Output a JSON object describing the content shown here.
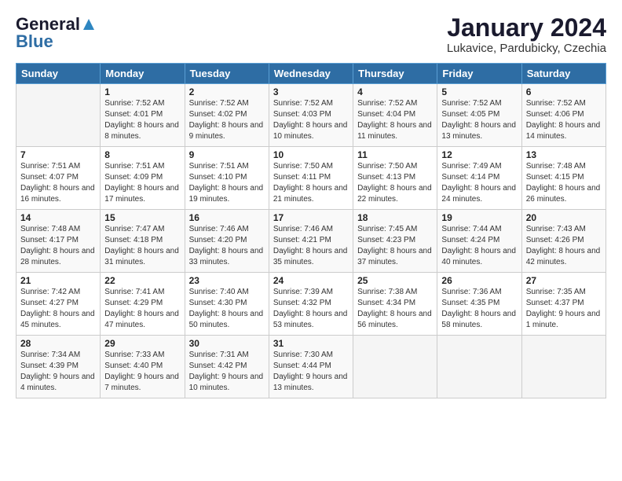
{
  "header": {
    "logo_general": "General",
    "logo_blue": "Blue",
    "title": "January 2024",
    "location": "Lukavice, Pardubicky, Czechia"
  },
  "days_of_week": [
    "Sunday",
    "Monday",
    "Tuesday",
    "Wednesday",
    "Thursday",
    "Friday",
    "Saturday"
  ],
  "weeks": [
    [
      {
        "day": "",
        "sunrise": "",
        "sunset": "",
        "daylight": ""
      },
      {
        "day": "1",
        "sunrise": "Sunrise: 7:52 AM",
        "sunset": "Sunset: 4:01 PM",
        "daylight": "Daylight: 8 hours and 8 minutes."
      },
      {
        "day": "2",
        "sunrise": "Sunrise: 7:52 AM",
        "sunset": "Sunset: 4:02 PM",
        "daylight": "Daylight: 8 hours and 9 minutes."
      },
      {
        "day": "3",
        "sunrise": "Sunrise: 7:52 AM",
        "sunset": "Sunset: 4:03 PM",
        "daylight": "Daylight: 8 hours and 10 minutes."
      },
      {
        "day": "4",
        "sunrise": "Sunrise: 7:52 AM",
        "sunset": "Sunset: 4:04 PM",
        "daylight": "Daylight: 8 hours and 11 minutes."
      },
      {
        "day": "5",
        "sunrise": "Sunrise: 7:52 AM",
        "sunset": "Sunset: 4:05 PM",
        "daylight": "Daylight: 8 hours and 13 minutes."
      },
      {
        "day": "6",
        "sunrise": "Sunrise: 7:52 AM",
        "sunset": "Sunset: 4:06 PM",
        "daylight": "Daylight: 8 hours and 14 minutes."
      }
    ],
    [
      {
        "day": "7",
        "sunrise": "Sunrise: 7:51 AM",
        "sunset": "Sunset: 4:07 PM",
        "daylight": "Daylight: 8 hours and 16 minutes."
      },
      {
        "day": "8",
        "sunrise": "Sunrise: 7:51 AM",
        "sunset": "Sunset: 4:09 PM",
        "daylight": "Daylight: 8 hours and 17 minutes."
      },
      {
        "day": "9",
        "sunrise": "Sunrise: 7:51 AM",
        "sunset": "Sunset: 4:10 PM",
        "daylight": "Daylight: 8 hours and 19 minutes."
      },
      {
        "day": "10",
        "sunrise": "Sunrise: 7:50 AM",
        "sunset": "Sunset: 4:11 PM",
        "daylight": "Daylight: 8 hours and 21 minutes."
      },
      {
        "day": "11",
        "sunrise": "Sunrise: 7:50 AM",
        "sunset": "Sunset: 4:13 PM",
        "daylight": "Daylight: 8 hours and 22 minutes."
      },
      {
        "day": "12",
        "sunrise": "Sunrise: 7:49 AM",
        "sunset": "Sunset: 4:14 PM",
        "daylight": "Daylight: 8 hours and 24 minutes."
      },
      {
        "day": "13",
        "sunrise": "Sunrise: 7:48 AM",
        "sunset": "Sunset: 4:15 PM",
        "daylight": "Daylight: 8 hours and 26 minutes."
      }
    ],
    [
      {
        "day": "14",
        "sunrise": "Sunrise: 7:48 AM",
        "sunset": "Sunset: 4:17 PM",
        "daylight": "Daylight: 8 hours and 28 minutes."
      },
      {
        "day": "15",
        "sunrise": "Sunrise: 7:47 AM",
        "sunset": "Sunset: 4:18 PM",
        "daylight": "Daylight: 8 hours and 31 minutes."
      },
      {
        "day": "16",
        "sunrise": "Sunrise: 7:46 AM",
        "sunset": "Sunset: 4:20 PM",
        "daylight": "Daylight: 8 hours and 33 minutes."
      },
      {
        "day": "17",
        "sunrise": "Sunrise: 7:46 AM",
        "sunset": "Sunset: 4:21 PM",
        "daylight": "Daylight: 8 hours and 35 minutes."
      },
      {
        "day": "18",
        "sunrise": "Sunrise: 7:45 AM",
        "sunset": "Sunset: 4:23 PM",
        "daylight": "Daylight: 8 hours and 37 minutes."
      },
      {
        "day": "19",
        "sunrise": "Sunrise: 7:44 AM",
        "sunset": "Sunset: 4:24 PM",
        "daylight": "Daylight: 8 hours and 40 minutes."
      },
      {
        "day": "20",
        "sunrise": "Sunrise: 7:43 AM",
        "sunset": "Sunset: 4:26 PM",
        "daylight": "Daylight: 8 hours and 42 minutes."
      }
    ],
    [
      {
        "day": "21",
        "sunrise": "Sunrise: 7:42 AM",
        "sunset": "Sunset: 4:27 PM",
        "daylight": "Daylight: 8 hours and 45 minutes."
      },
      {
        "day": "22",
        "sunrise": "Sunrise: 7:41 AM",
        "sunset": "Sunset: 4:29 PM",
        "daylight": "Daylight: 8 hours and 47 minutes."
      },
      {
        "day": "23",
        "sunrise": "Sunrise: 7:40 AM",
        "sunset": "Sunset: 4:30 PM",
        "daylight": "Daylight: 8 hours and 50 minutes."
      },
      {
        "day": "24",
        "sunrise": "Sunrise: 7:39 AM",
        "sunset": "Sunset: 4:32 PM",
        "daylight": "Daylight: 8 hours and 53 minutes."
      },
      {
        "day": "25",
        "sunrise": "Sunrise: 7:38 AM",
        "sunset": "Sunset: 4:34 PM",
        "daylight": "Daylight: 8 hours and 56 minutes."
      },
      {
        "day": "26",
        "sunrise": "Sunrise: 7:36 AM",
        "sunset": "Sunset: 4:35 PM",
        "daylight": "Daylight: 8 hours and 58 minutes."
      },
      {
        "day": "27",
        "sunrise": "Sunrise: 7:35 AM",
        "sunset": "Sunset: 4:37 PM",
        "daylight": "Daylight: 9 hours and 1 minute."
      }
    ],
    [
      {
        "day": "28",
        "sunrise": "Sunrise: 7:34 AM",
        "sunset": "Sunset: 4:39 PM",
        "daylight": "Daylight: 9 hours and 4 minutes."
      },
      {
        "day": "29",
        "sunrise": "Sunrise: 7:33 AM",
        "sunset": "Sunset: 4:40 PM",
        "daylight": "Daylight: 9 hours and 7 minutes."
      },
      {
        "day": "30",
        "sunrise": "Sunrise: 7:31 AM",
        "sunset": "Sunset: 4:42 PM",
        "daylight": "Daylight: 9 hours and 10 minutes."
      },
      {
        "day": "31",
        "sunrise": "Sunrise: 7:30 AM",
        "sunset": "Sunset: 4:44 PM",
        "daylight": "Daylight: 9 hours and 13 minutes."
      },
      {
        "day": "",
        "sunrise": "",
        "sunset": "",
        "daylight": ""
      },
      {
        "day": "",
        "sunrise": "",
        "sunset": "",
        "daylight": ""
      },
      {
        "day": "",
        "sunrise": "",
        "sunset": "",
        "daylight": ""
      }
    ]
  ]
}
